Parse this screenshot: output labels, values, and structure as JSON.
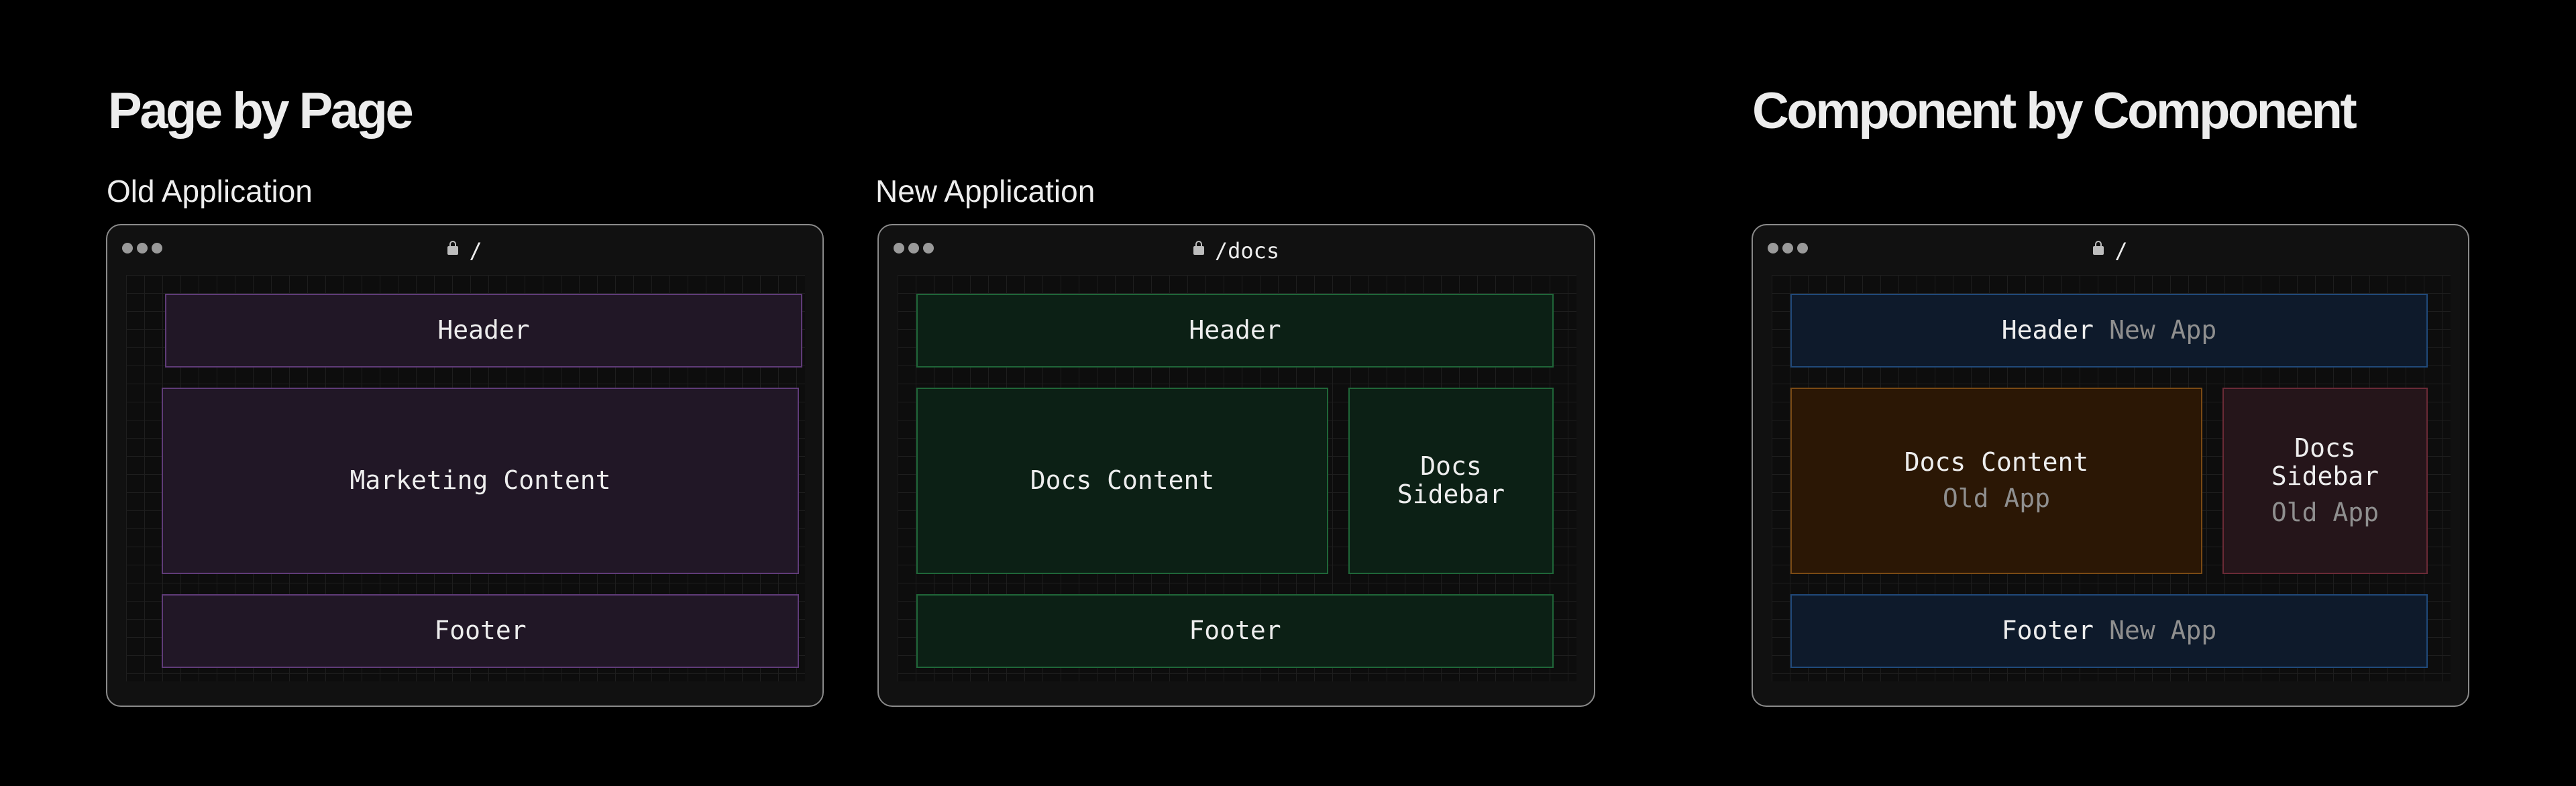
{
  "headings": {
    "page_by_page": "Page by Page",
    "component_by_component": "Component by Component"
  },
  "labels": {
    "old_application": "Old Application",
    "new_application": "New Application"
  },
  "windows": {
    "old": {
      "url": "/",
      "header": "Header",
      "content": "Marketing Content",
      "footer": "Footer"
    },
    "new": {
      "url": "/docs",
      "header": "Header",
      "content": "Docs Content",
      "sidebar_line1": "Docs",
      "sidebar_line2": "Sidebar",
      "footer": "Footer"
    },
    "component": {
      "url": "/",
      "header": "Header",
      "header_note": "New App",
      "content": "Docs Content",
      "content_note": "Old App",
      "sidebar_line1": "Docs",
      "sidebar_line2": "Sidebar",
      "sidebar_note": "Old App",
      "footer": "Footer",
      "footer_note": "New App"
    }
  },
  "colors": {
    "purple_fill": "#211726",
    "green_fill": "#0c2015",
    "blue_fill": "#0e1a2b",
    "orange_fill": "#2b1705",
    "red_fill": "#25151a"
  }
}
